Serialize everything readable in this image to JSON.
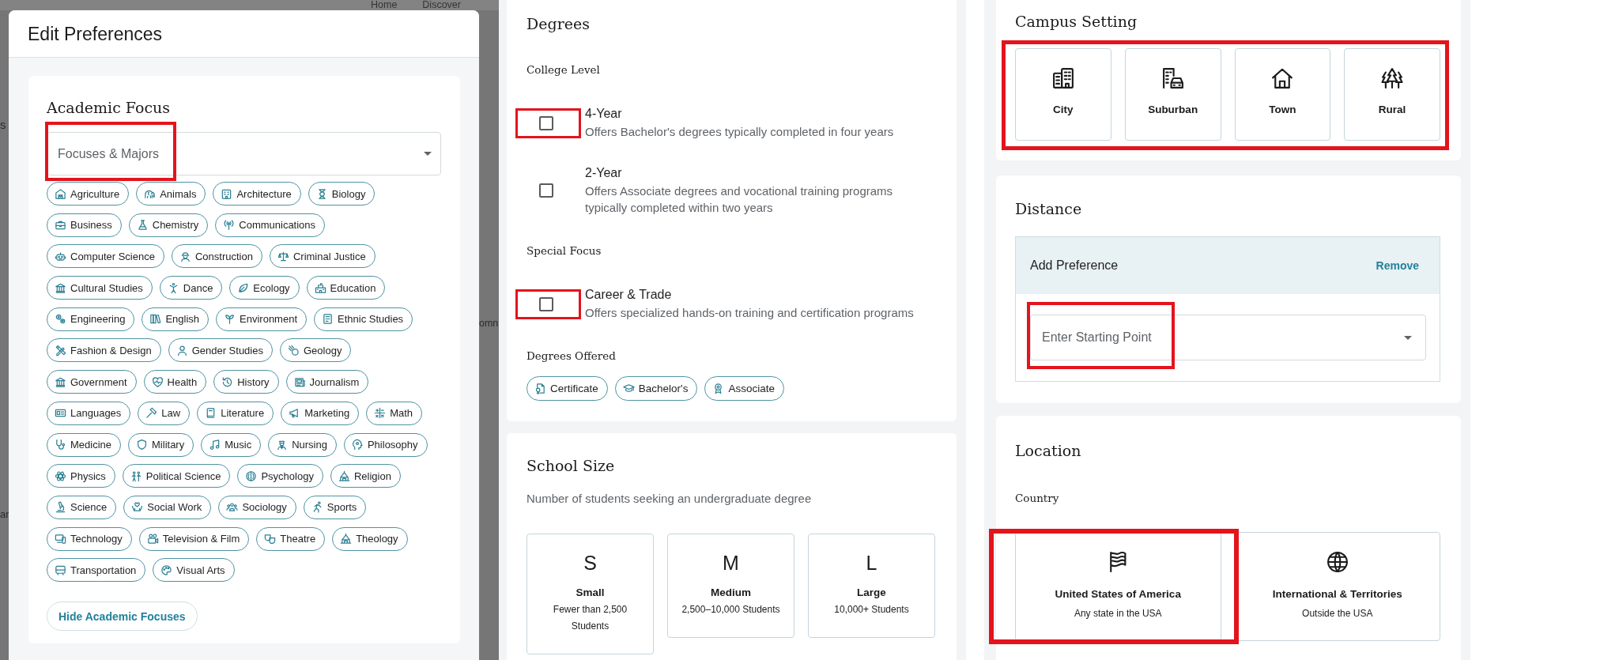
{
  "backdrop": {
    "nav": [
      "Home",
      "Discover"
    ],
    "fragments": [
      "s",
      "omn",
      "ar"
    ]
  },
  "modal": {
    "title": "Edit Preferences",
    "academic_focus": {
      "title": "Academic Focus",
      "dropdown": {
        "placeholder": "Focuses & Majors",
        "highlighted": true
      },
      "chips": [
        {
          "label": "Agriculture",
          "selected": false
        },
        {
          "label": "Animals",
          "selected": false
        },
        {
          "label": "Architecture",
          "selected": false
        },
        {
          "label": "Biology",
          "selected": false
        },
        {
          "label": "Business",
          "selected": false
        },
        {
          "label": "Chemistry",
          "selected": false
        },
        {
          "label": "Communications",
          "selected": false
        },
        {
          "label": "Computer Science",
          "selected": false
        },
        {
          "label": "Construction",
          "selected": false
        },
        {
          "label": "Criminal Justice",
          "selected": false
        },
        {
          "label": "Cultural Studies",
          "selected": false
        },
        {
          "label": "Dance",
          "selected": false
        },
        {
          "label": "Ecology",
          "selected": false
        },
        {
          "label": "Education",
          "selected": false
        },
        {
          "label": "Engineering",
          "selected": false
        },
        {
          "label": "English",
          "selected": false
        },
        {
          "label": "Environment",
          "selected": false
        },
        {
          "label": "Ethnic Studies",
          "selected": false
        },
        {
          "label": "Fashion & Design",
          "selected": false
        },
        {
          "label": "Gender Studies",
          "selected": false
        },
        {
          "label": "Geology",
          "selected": false
        },
        {
          "label": "Government",
          "selected": false
        },
        {
          "label": "Health",
          "selected": false
        },
        {
          "label": "History",
          "selected": false
        },
        {
          "label": "Journalism",
          "selected": false
        },
        {
          "label": "Languages",
          "selected": false
        },
        {
          "label": "Law",
          "selected": false
        },
        {
          "label": "Literature",
          "selected": false
        },
        {
          "label": "Marketing",
          "selected": false
        },
        {
          "label": "Math",
          "selected": false
        },
        {
          "label": "Medicine",
          "selected": false
        },
        {
          "label": "Military",
          "selected": false
        },
        {
          "label": "Music",
          "selected": false
        },
        {
          "label": "Nursing",
          "selected": false
        },
        {
          "label": "Philosophy",
          "selected": false
        },
        {
          "label": "Physics",
          "selected": false
        },
        {
          "label": "Political Science",
          "selected": false
        },
        {
          "label": "Psychology",
          "selected": false
        },
        {
          "label": "Religion",
          "selected": false
        },
        {
          "label": "Science",
          "selected": false
        },
        {
          "label": "Social Work",
          "selected": false
        },
        {
          "label": "Sociology",
          "selected": false
        },
        {
          "label": "Sports",
          "selected": false
        },
        {
          "label": "Technology",
          "selected": false
        },
        {
          "label": "Television & Film",
          "selected": false
        },
        {
          "label": "Theatre",
          "selected": false
        },
        {
          "label": "Theology",
          "selected": false
        },
        {
          "label": "Transportation",
          "selected": false
        },
        {
          "label": "Visual Arts",
          "selected": false
        }
      ],
      "toggle_button": "Hide Academic Focuses"
    }
  },
  "degrees": {
    "title": "Degrees",
    "groups": [
      {
        "title": "College Level",
        "options": [
          {
            "title": "4-Year",
            "description": "Offers Bachelor's degrees typically completed in four years",
            "checked": false,
            "highlighted": true
          },
          {
            "title": "2-Year",
            "description": "Offers Associate degrees and vocational training programs typically completed within two years",
            "checked": false,
            "highlighted": false
          }
        ]
      },
      {
        "title": "Special Focus",
        "options": [
          {
            "title": "Career & Trade",
            "description": "Offers specialized hands-on training and certification programs",
            "checked": false,
            "highlighted": true
          }
        ]
      }
    ],
    "offered": {
      "title": "Degrees Offered",
      "chips": [
        {
          "label": "Certificate",
          "selected": false
        },
        {
          "label": "Bachelor's",
          "selected": false
        },
        {
          "label": "Associate",
          "selected": false
        }
      ]
    }
  },
  "school_size": {
    "title": "School Size",
    "description": "Number of students seeking an undergraduate degree",
    "options": [
      {
        "letter": "S",
        "label": "Small",
        "description": "Fewer than 2,500 Students",
        "selected": false
      },
      {
        "letter": "M",
        "label": "Medium",
        "description": "2,500–10,000 Students",
        "selected": false
      },
      {
        "letter": "L",
        "label": "Large",
        "description": "10,000+ Students",
        "selected": false
      }
    ]
  },
  "campus_setting": {
    "title": "Campus Setting",
    "highlighted": true,
    "options": [
      {
        "label": "City",
        "selected": false
      },
      {
        "label": "Suburban",
        "selected": false
      },
      {
        "label": "Town",
        "selected": false
      },
      {
        "label": "Rural",
        "selected": false
      }
    ]
  },
  "distance": {
    "title": "Distance",
    "preference": {
      "title": "Add Preference",
      "action": "Remove",
      "field": {
        "placeholder": "Enter Starting Point",
        "highlighted": true
      }
    }
  },
  "location": {
    "title": "Location",
    "subtitle": "Country",
    "options": [
      {
        "label": "United States of America",
        "description": "Any state in the USA",
        "selected": false,
        "highlighted": true
      },
      {
        "label": "International & Territories",
        "description": "Outside the USA",
        "selected": false,
        "highlighted": false
      }
    ]
  }
}
